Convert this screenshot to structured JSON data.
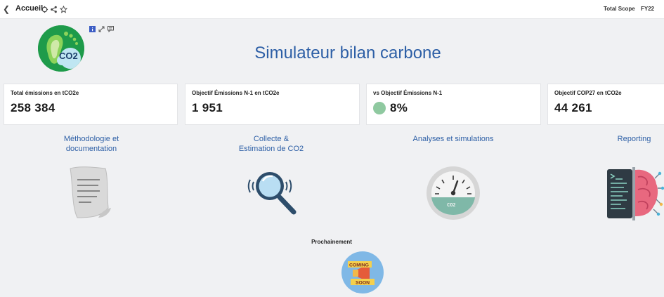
{
  "topbar": {
    "title": "Accueil",
    "scope_label": "Total Scope",
    "year_label": "FY22"
  },
  "header": {
    "title": "Simulateur bilan carbone",
    "logo_text": "CO2"
  },
  "kpis": [
    {
      "label": "Total émissions en tCO2e",
      "value": "258 384"
    },
    {
      "label": "Objectif Émissions N-1 en tCO2e",
      "value": "1 951"
    },
    {
      "label": "vs Objectif Émissions N-1",
      "value": "8%",
      "indicator_color": "#8fc9a0"
    },
    {
      "label": "Objectif COP27 en tCO2e",
      "value": "44 261"
    }
  ],
  "sections": [
    {
      "title_line1": "Méthodologie et",
      "title_line2": "documentation"
    },
    {
      "title_line1": "Collecte &",
      "title_line2": "Estimation de CO2"
    },
    {
      "title_line1": "Analyses et simulations",
      "title_line2": ""
    },
    {
      "title_line1": "Reporting",
      "title_line2": ""
    }
  ],
  "gauge_text": "CO2",
  "coming_soon": {
    "label": "Prochainement",
    "badge_line1": "COMING",
    "badge_line2": "SOON"
  },
  "colors": {
    "accent": "#2d5fa6",
    "logo_green": "#1e9b4a",
    "background": "#f0f1f3"
  }
}
